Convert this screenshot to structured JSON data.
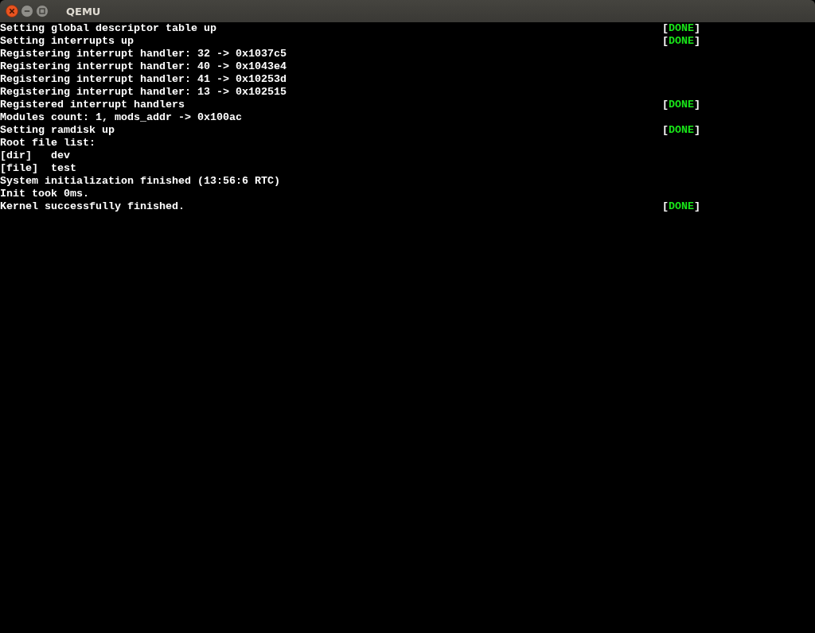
{
  "window": {
    "title": "QEMU"
  },
  "console": {
    "lines": [
      {
        "text": "Setting global descriptor table up",
        "status": {
          "open": "[",
          "label": "DONE",
          "close": "]"
        }
      },
      {
        "text": "Setting interrupts up",
        "status": {
          "open": "[",
          "label": "DONE",
          "close": "]"
        }
      },
      {
        "text": "Registering interrupt handler: 32 -> 0x1037c5"
      },
      {
        "text": "Registering interrupt handler: 40 -> 0x1043e4"
      },
      {
        "text": "Registering interrupt handler: 41 -> 0x10253d"
      },
      {
        "text": "Registering interrupt handler: 13 -> 0x102515"
      },
      {
        "text": "Registered interrupt handlers",
        "status": {
          "open": "[",
          "label": "DONE",
          "close": "]"
        }
      },
      {
        "text": "Modules count: 1, mods_addr -> 0x100ac"
      },
      {
        "text": "Setting ramdisk up",
        "status": {
          "open": "[",
          "label": "DONE",
          "close": "]"
        }
      },
      {
        "text": "Root file list:"
      },
      {
        "text": "[dir]   dev"
      },
      {
        "text": "[file]  test"
      },
      {
        "text": "System initialization finished (13:56:6 RTC)"
      },
      {
        "text": "Init took 0ms."
      },
      {
        "text": "Kernel successfully finished.",
        "status": {
          "open": "[",
          "label": "DONE",
          "close": "]"
        }
      }
    ]
  }
}
